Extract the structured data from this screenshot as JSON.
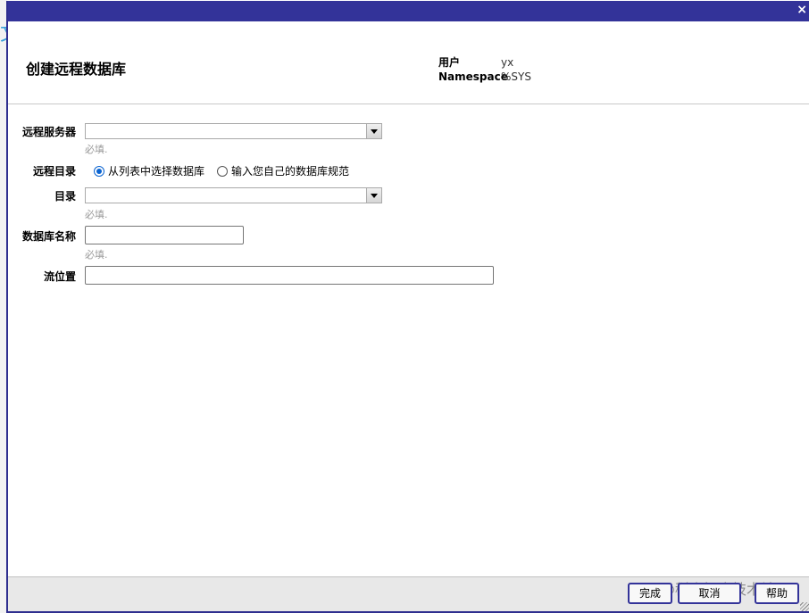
{
  "dialog": {
    "title": "创建远程数据库",
    "close_glyph": "×",
    "meta": {
      "user_label": "用户",
      "user_value": "yx",
      "namespace_label": "Namespace",
      "namespace_value": "%SYS"
    }
  },
  "form": {
    "remote_server": {
      "label": "远程服务器",
      "value": "",
      "hint": "必填."
    },
    "remote_directory": {
      "label": "远程目录",
      "options": [
        "从列表中选择数据库",
        "输入您自己的数据库规范"
      ],
      "selected_index": 0
    },
    "directory": {
      "label": "目录",
      "value": "",
      "hint": "必填."
    },
    "database_name": {
      "label": "数据库名称",
      "value": "",
      "hint": "必填."
    },
    "stream_location": {
      "label": "流位置",
      "value": ""
    }
  },
  "footer": {
    "finish_label": "完成",
    "cancel_label": "取消",
    "help_label": "帮助",
    "watermark": "@稀土掘金技术社区"
  }
}
